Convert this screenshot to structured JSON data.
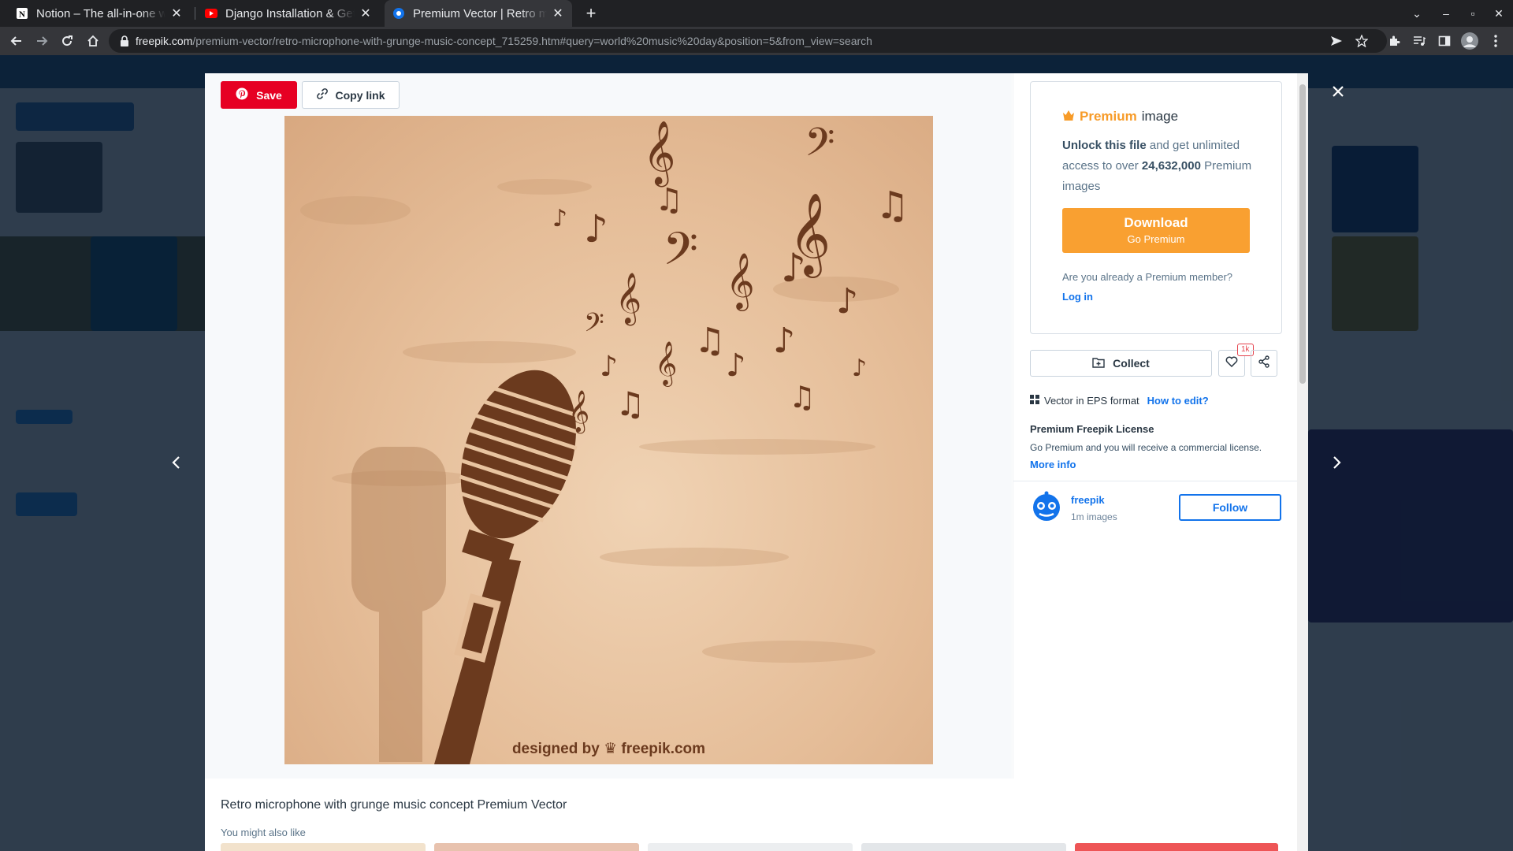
{
  "browser": {
    "tabs": [
      {
        "title": "Notion – The all-in-one workspace",
        "favicon": "notion-icon"
      },
      {
        "title": "Django Installation & Getting Started",
        "favicon": "youtube-icon"
      },
      {
        "title": "Premium Vector | Retro microphone",
        "favicon": "freepik-icon"
      }
    ],
    "url_host": "freepik.com",
    "url_path": "/premium-vector/retro-microphone-with-grunge-music-concept_715259.htm#query=world%20music%20day&position=5&from_view=search"
  },
  "modal": {
    "save_label": "Save",
    "copy_link_label": "Copy link",
    "watermark_designed": "designed by",
    "watermark_brand": "freepik.com",
    "premium": {
      "accent": "Premium",
      "title_rest": "image",
      "unlock": "Unlock this file",
      "desc_mid": "and get unlimited access to over",
      "count": "24,632,000",
      "desc_end": "Premium images",
      "download_label": "Download",
      "download_sub": "Go Premium",
      "already_member": "Are you already a Premium member?",
      "login": "Log in"
    },
    "collect_label": "Collect",
    "like_count": "1k",
    "format_text": "Vector in EPS format",
    "how_to_edit": "How to edit?",
    "license_title": "Premium Freepik License",
    "license_desc": "Go Premium and you will receive a commercial license.",
    "more_info": "More info",
    "author": {
      "name": "freepik",
      "count": "1m images"
    },
    "follow_label": "Follow",
    "image_title": "Retro microphone with grunge music concept Premium Vector",
    "also_like": "You might also like"
  },
  "colors": {
    "save_red": "#e60023",
    "premium_orange": "#f79b28",
    "download_orange": "#f9a031",
    "link_blue": "#1273eb",
    "art_brown": "#6b3a1e"
  },
  "icons": [
    "pinterest-icon",
    "link-icon",
    "crown-icon",
    "folder-add-icon",
    "heart-icon",
    "share-icon",
    "grid-icon",
    "close-icon",
    "chevron-left-icon",
    "chevron-right-icon"
  ]
}
